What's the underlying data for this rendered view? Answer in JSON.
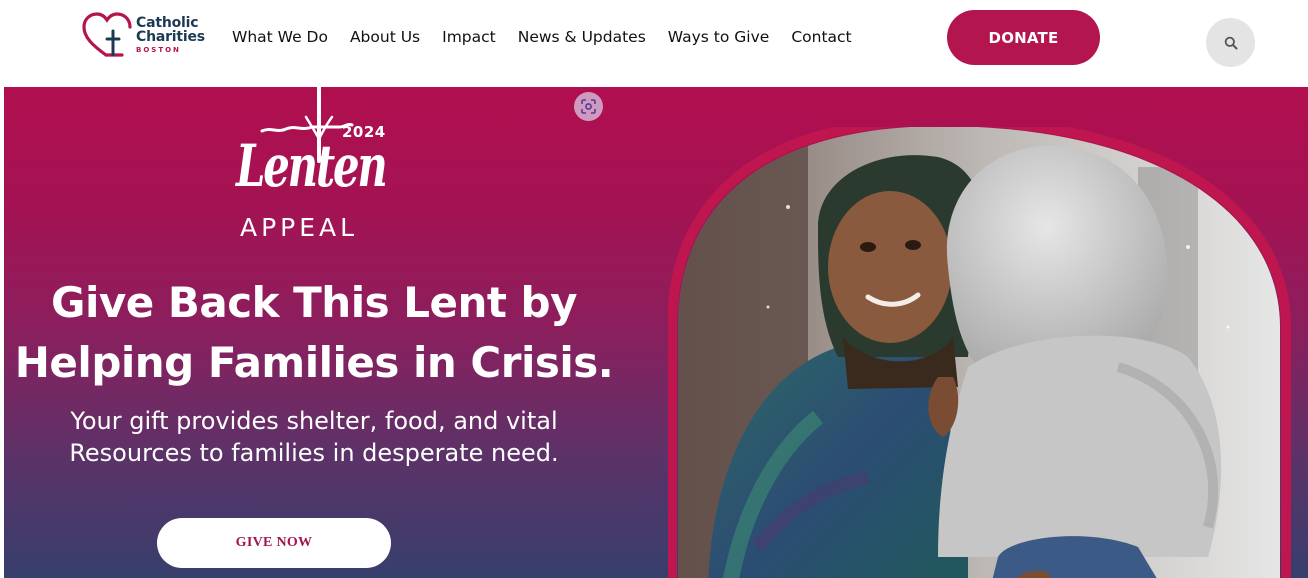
{
  "header": {
    "logo": {
      "line1": "Catholic",
      "line2": "Charities",
      "line3": "BOSTON"
    },
    "nav": [
      {
        "label": "What We Do"
      },
      {
        "label": "About Us"
      },
      {
        "label": "Impact"
      },
      {
        "label": "News & Updates"
      },
      {
        "label": "Ways to Give"
      },
      {
        "label": "Contact"
      }
    ],
    "donate_label": "DONATE",
    "search_icon": "search-icon"
  },
  "hero": {
    "lenten": {
      "year": "2024",
      "script": "Lenten",
      "appeal": "APPEAL"
    },
    "headline_line1": "Give Back This Lent by",
    "headline_line2": "Helping Families in Crisis.",
    "subhead_line1": "Your gift provides shelter, food, and vital",
    "subhead_line2": "Resources to families in desperate need.",
    "give_label": "GIVE NOW",
    "lens_icon": "visual-search-icon",
    "photo": "mother-holding-child-photo"
  },
  "colors": {
    "brand_crimson": "#b3154f",
    "brand_navy": "#1d3a54",
    "hero_top": "#b10f4f",
    "hero_bottom": "#373f6c",
    "search_bg": "#e4e4e4"
  }
}
